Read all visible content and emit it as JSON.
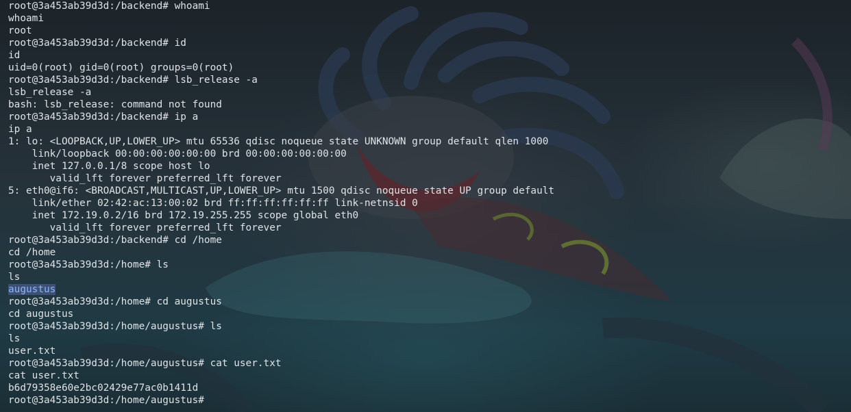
{
  "terminal": {
    "lines": [
      "root@3a453ab39d3d:/backend# whoami",
      "whoami",
      "root",
      "root@3a453ab39d3d:/backend# id",
      "id",
      "uid=0(root) gid=0(root) groups=0(root)",
      "root@3a453ab39d3d:/backend# lsb_release -a",
      "lsb_release -a",
      "bash: lsb_release: command not found",
      "root@3a453ab39d3d:/backend# ip a",
      "ip a",
      "1: lo: <LOOPBACK,UP,LOWER_UP> mtu 65536 qdisc noqueue state UNKNOWN group default qlen 1000",
      "    link/loopback 00:00:00:00:00:00 brd 00:00:00:00:00:00",
      "    inet 127.0.0.1/8 scope host lo",
      "       valid_lft forever preferred_lft forever",
      "5: eth0@if6: <BROADCAST,MULTICAST,UP,LOWER_UP> mtu 1500 qdisc noqueue state UP group default",
      "    link/ether 02:42:ac:13:00:02 brd ff:ff:ff:ff:ff:ff link-netnsid 0",
      "    inet 172.19.0.2/16 brd 172.19.255.255 scope global eth0",
      "       valid_lft forever preferred_lft forever",
      "root@3a453ab39d3d:/backend# cd /home",
      "cd /home",
      "root@3a453ab39d3d:/home# ls",
      "ls",
      "augustus",
      "root@3a453ab39d3d:/home# cd augustus",
      "cd augustus",
      "root@3a453ab39d3d:/home/augustus# ls",
      "ls",
      "user.txt",
      "root@3a453ab39d3d:/home/augustus# cat user.txt",
      "cat user.txt",
      "b6d79358e60e2bc02429e77ac0b1411d",
      "root@3a453ab39d3d:/home/augustus# "
    ],
    "selected_line_index": 23
  },
  "colors": {
    "text": "#dfe3e6",
    "selection_text": "#8fb3ff",
    "background": "#1f2a31"
  }
}
